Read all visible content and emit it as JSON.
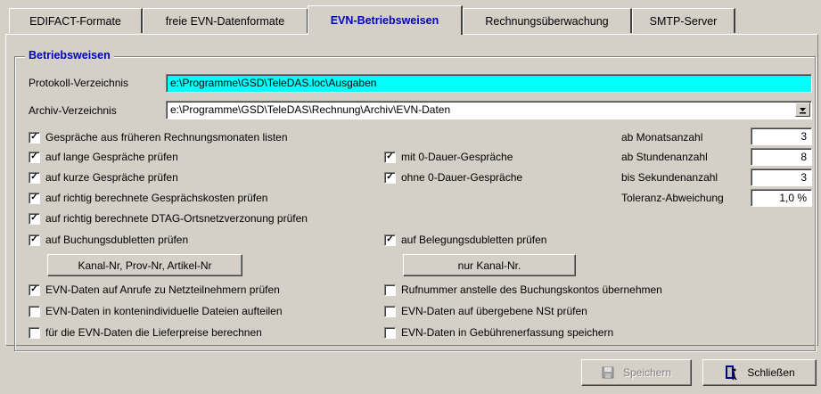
{
  "tabs": [
    {
      "label": "EDIFACT-Formate"
    },
    {
      "label": "freie EVN-Datenformate"
    },
    {
      "label": "EVN-Betriebsweisen"
    },
    {
      "label": "Rechnungsüberwachung"
    },
    {
      "label": "SMTP-Server"
    }
  ],
  "group": {
    "title": "Betriebsweisen"
  },
  "protokoll": {
    "label": "Protokoll-Verzeichnis",
    "value": "e:\\Programme\\GSD\\TeleDAS.loc\\Ausgaben"
  },
  "archiv": {
    "label": "Archiv-Verzeichnis",
    "value": "e:\\Programme\\GSD\\TeleDAS\\Rechnung\\Archiv\\EVN-Daten"
  },
  "checks": {
    "fruehere": {
      "label": "Gespräche aus früheren Rechnungsmonaten listen",
      "checked": true
    },
    "lange": {
      "label": "auf lange Gespräche prüfen",
      "checked": true
    },
    "kurze": {
      "label": "auf kurze Gespräche prüfen",
      "checked": true
    },
    "kosten": {
      "label": "auf richtig berechnete Gesprächskosten prüfen",
      "checked": true
    },
    "dtag": {
      "label": "auf richtig berechnete DTAG-Ortsnetzverzonung prüfen",
      "checked": true
    },
    "buchung": {
      "label": "auf Buchungsdubletten prüfen",
      "checked": true
    },
    "mit0": {
      "label": "mit 0-Dauer-Gespräche",
      "checked": true
    },
    "ohne0": {
      "label": "ohne 0-Dauer-Gespräche",
      "checked": true
    },
    "belegung": {
      "label": "auf Belegungsdubletten prüfen",
      "checked": true
    },
    "netzteil": {
      "label": "EVN-Daten auf Anrufe zu Netzteilnehmern prüfen",
      "checked": true
    },
    "konten": {
      "label": "EVN-Daten in kontenindividuelle Dateien aufteilen",
      "checked": false
    },
    "liefer": {
      "label": "für die EVN-Daten die Lieferpreise berechnen",
      "checked": false
    },
    "rufnummer": {
      "label": "Rufnummer anstelle des Buchungskontos übernehmen",
      "checked": false
    },
    "nst": {
      "label": "EVN-Daten auf übergebene NSt prüfen",
      "checked": false
    },
    "gebuehr": {
      "label": "EVN-Daten in Gebührenerfassung speichern",
      "checked": false
    }
  },
  "params": {
    "monat": {
      "label": "ab Monatsanzahl",
      "value": "3"
    },
    "stunde": {
      "label": "ab Stundenanzahl",
      "value": "8"
    },
    "sekunde": {
      "label": "bis Sekundenanzahl",
      "value": "3"
    },
    "toleranz": {
      "label": "Toleranz-Abweichung",
      "value": "1,0 %"
    }
  },
  "buttons": {
    "kanal_prov": "Kanal-Nr, Prov-Nr, Artikel-Nr",
    "nur_kanal": "nur Kanal-Nr.",
    "speichern": "Speichern",
    "schliessen": "Schließen"
  },
  "icons": {
    "dropdown": "dropdown-arrow-icon",
    "save": "floppy-disk-icon",
    "close": "door-exit-icon"
  }
}
